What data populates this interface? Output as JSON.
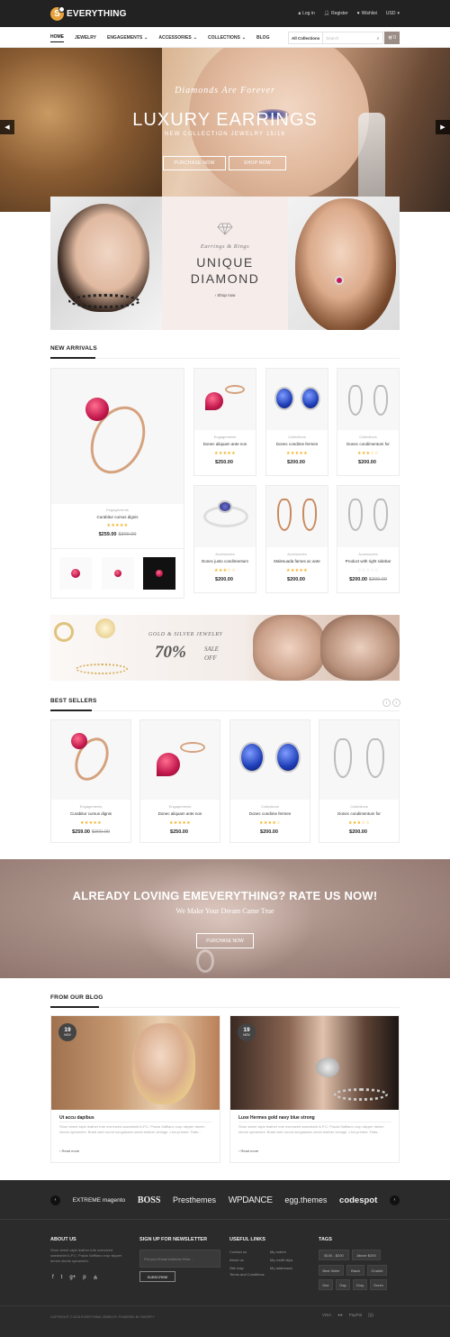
{
  "header": {
    "logo_letter": "S",
    "logo_text": "EVERYTHING",
    "links": [
      "Log in",
      "Register",
      "Wishlist",
      "USD"
    ]
  },
  "nav": {
    "items": [
      "HOME",
      "JEWELRY",
      "ENGAGEMENTS",
      "ACCESSORIES",
      "COLLECTIONS",
      "BLOG"
    ],
    "search_collection": "All Collections",
    "search_placeholder": "Search",
    "cart_count": "0"
  },
  "hero": {
    "subtitle": "Diamonds Are Forever",
    "title": "LUXURY EARRINGS",
    "collection": "NEW COLLECTION JEWELRY 15/16",
    "btn_purchase": "PURCHASE NOW",
    "btn_shop": "SHOP NOW"
  },
  "banner": {
    "subtitle": "Earrings & Rings",
    "title1": "UNIQUE",
    "title2": "DIAMOND",
    "shop": "Shop now"
  },
  "new_arrivals": {
    "title": "NEW ARRIVALS",
    "featured": {
      "category": "Engagements",
      "name": "Curabitur cursus dignis",
      "stars": "★★★★★",
      "price": "$259.00",
      "old_price": "$300.00"
    },
    "products": [
      {
        "category": "Engagements",
        "name": "Donec aliquam ante non",
        "stars": "★★★★★",
        "price": "$250.00",
        "old_price": ""
      },
      {
        "category": "Collections",
        "name": "Donec condime fermen",
        "stars": "★★★★★",
        "price": "$200.00",
        "old_price": ""
      },
      {
        "category": "Collections",
        "name": "Donec condimentum for",
        "stars": "★★★☆☆",
        "price": "$200.00",
        "old_price": ""
      },
      {
        "category": "Accessories",
        "name": "Donec justo condimentum",
        "stars": "★★★☆☆",
        "price": "$200.00",
        "old_price": ""
      },
      {
        "category": "Accessories",
        "name": "Malesuada fames ac ante",
        "stars": "★★★★★",
        "price": "$200.00",
        "old_price": ""
      },
      {
        "category": "Accessories",
        "name": "Product with right sidebar",
        "stars": "☆☆☆☆☆",
        "price": "$200.00",
        "old_price": "$300.00"
      }
    ]
  },
  "sale": {
    "subtitle": "GOLD & SILVER JEWELRY",
    "percent": "70%",
    "word1": "SALE",
    "word2": "OFF"
  },
  "best_sellers": {
    "title": "BEST SELLERS",
    "products": [
      {
        "category": "Engagements",
        "name": "Curabitur cursus dignis",
        "stars": "★★★★★",
        "price": "$259.00",
        "old_price": "$300.00"
      },
      {
        "category": "Engagements",
        "name": "Donec aliquam ante non",
        "stars": "★★★★★",
        "price": "$250.00",
        "old_price": ""
      },
      {
        "category": "Collections",
        "name": "Donec condime fermen",
        "stars": "★★★★☆",
        "price": "$200.00",
        "old_price": ""
      },
      {
        "category": "Collections",
        "name": "Donec condimentum for",
        "stars": "★★★☆☆",
        "price": "$200.00",
        "old_price": ""
      }
    ]
  },
  "rate": {
    "title": "ALREADY LOVING EMEVERYTHING? RATE US NOW!",
    "subtitle": "We Make Your Dream Came True",
    "button": "PURCHASE NOW"
  },
  "blog": {
    "title": "FROM OUR BLOG",
    "posts": [
      {
        "day": "19",
        "month": "NOV",
        "title": "Ut accu dapibus",
        "excerpt": "Shoe street style leather tote oversized sweatshirt A.P.C. Prada Saffiano crop slipper denim shorts spearmint. Braid skirt round sunglasses seam leather vintage. Live-printed. Flats...",
        "more": "Read more"
      },
      {
        "day": "19",
        "month": "NOV",
        "title": "Luxe Hermes gold navy blue strong",
        "excerpt": "Shoe street style leather tote oversized sweatshirt A.P.C. Prada Saffiano crop slipper denim shorts spearmint. Braid skirt round sunglasses seam leather vintage. Live-printed. Flats...",
        "more": "Read more"
      }
    ]
  },
  "footer": {
    "brands": [
      "EXTREME magento",
      "BOSS",
      "Presthemes",
      "WPDANCE",
      "egg.themes",
      "codespot"
    ],
    "about_title": "ABOUT US",
    "about_text": "Shoe street style leather tote oversized sweatshirt A.P.C. Prada Saffiano crop slipper denim shorts spearmint.",
    "newsletter_title": "SIGN UP FOR NEWSLETTER",
    "newsletter_placeholder": "Put your Email Address Here...",
    "newsletter_button": "SUBSCRIBE",
    "links_title": "USEFUL LINKS",
    "links_col1": [
      "Contact us",
      "About us",
      "Site map",
      "Terms and Conditions"
    ],
    "links_col2": [
      "My orders",
      "My credit slips",
      "My addresses"
    ],
    "tags_title": "TAGS",
    "tags": [
      "$100 - $200",
      "Above $200",
      "Best Seller",
      "Black",
      "Charlet",
      "Dior",
      "Gap",
      "Gray",
      "Green"
    ],
    "copyright": "COPYRIGHT © 2015 EVERYTHING JEWELRY. POWERED BY SHOPIFY",
    "payments": [
      "VISA",
      "●●",
      "PayPal",
      "))))"
    ]
  }
}
